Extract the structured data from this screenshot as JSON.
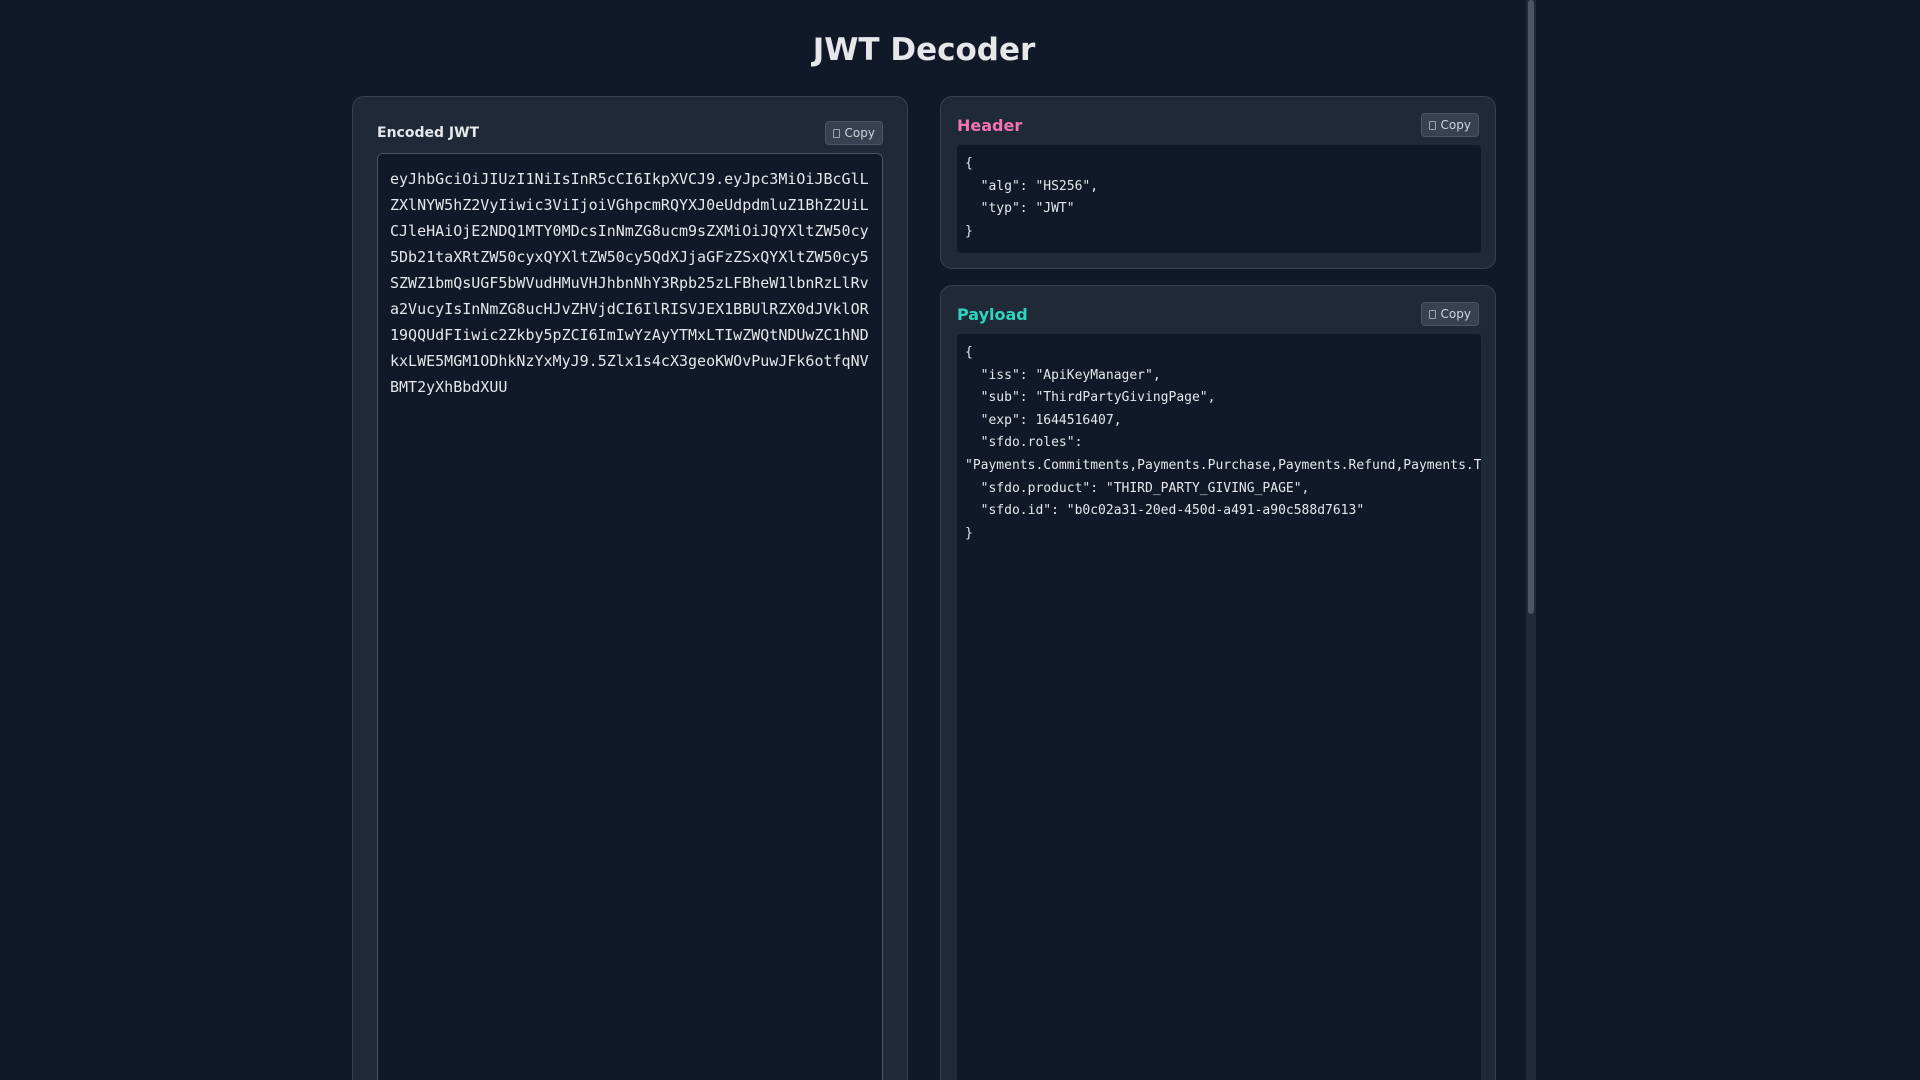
{
  "page": {
    "title": "JWT Decoder"
  },
  "encoded": {
    "label": "Encoded JWT",
    "copy_label": "Copy",
    "token": "eyJhbGciOiJIUzI1NiIsInR5cCI6IkpXVCJ9.eyJpc3MiOiJBcGlLZXlNYW5hZ2VyIiwic3ViIjoiVGhpcmRQYXJ0eUdpdmluZ1BhZ2UiLCJleHAiOjE2NDQ1MTY0MDcsInNmZG8ucm9sZXMiOiJQYXltZW50cy5Db21taXRtZW50cyxQYXltZW50cy5QdXJjaGFzZSxQYXltZW50cy5SZWZ1bmQsUGF5bWVudHMuVHJhbnNhY3Rpb25zLFBheW1lbnRzLlRva2VucyIsInNmZG8ucHJvZHVjdCI6IlRISVJEX1BBUlRZX0dJVklOR19QQUdFIiwic2Zkby5pZCI6ImIwYzAyYTMxLTIwZWQtNDUwZC1hNDkxLWE5MGM1ODhkNzYxMyJ9.5Zlx1s4cX3geoKWOvPuwJFk6otfqNVBMT2yXhBbdXUU"
  },
  "header": {
    "label": "Header",
    "label_color": "#f472b6",
    "copy_label": "Copy",
    "json": "{\n  \"alg\": \"HS256\",\n  \"typ\": \"JWT\"\n}"
  },
  "payload": {
    "label": "Payload",
    "label_color": "#2dd4bf",
    "copy_label": "Copy",
    "json": "{\n  \"iss\": \"ApiKeyManager\",\n  \"sub\": \"ThirdPartyGivingPage\",\n  \"exp\": 1644516407,\n  \"sfdo.roles\":\n\"Payments.Commitments,Payments.Purchase,Payments.Refund,Payments.Transactions,Payments.Tokens\",\n  \"sfdo.product\": \"THIRD_PARTY_GIVING_PAGE\",\n  \"sfdo.id\": \"b0c02a31-20ed-450d-a491-a90c588d7613\"\n}"
  },
  "icons": {
    "copy": "copy-icon"
  }
}
